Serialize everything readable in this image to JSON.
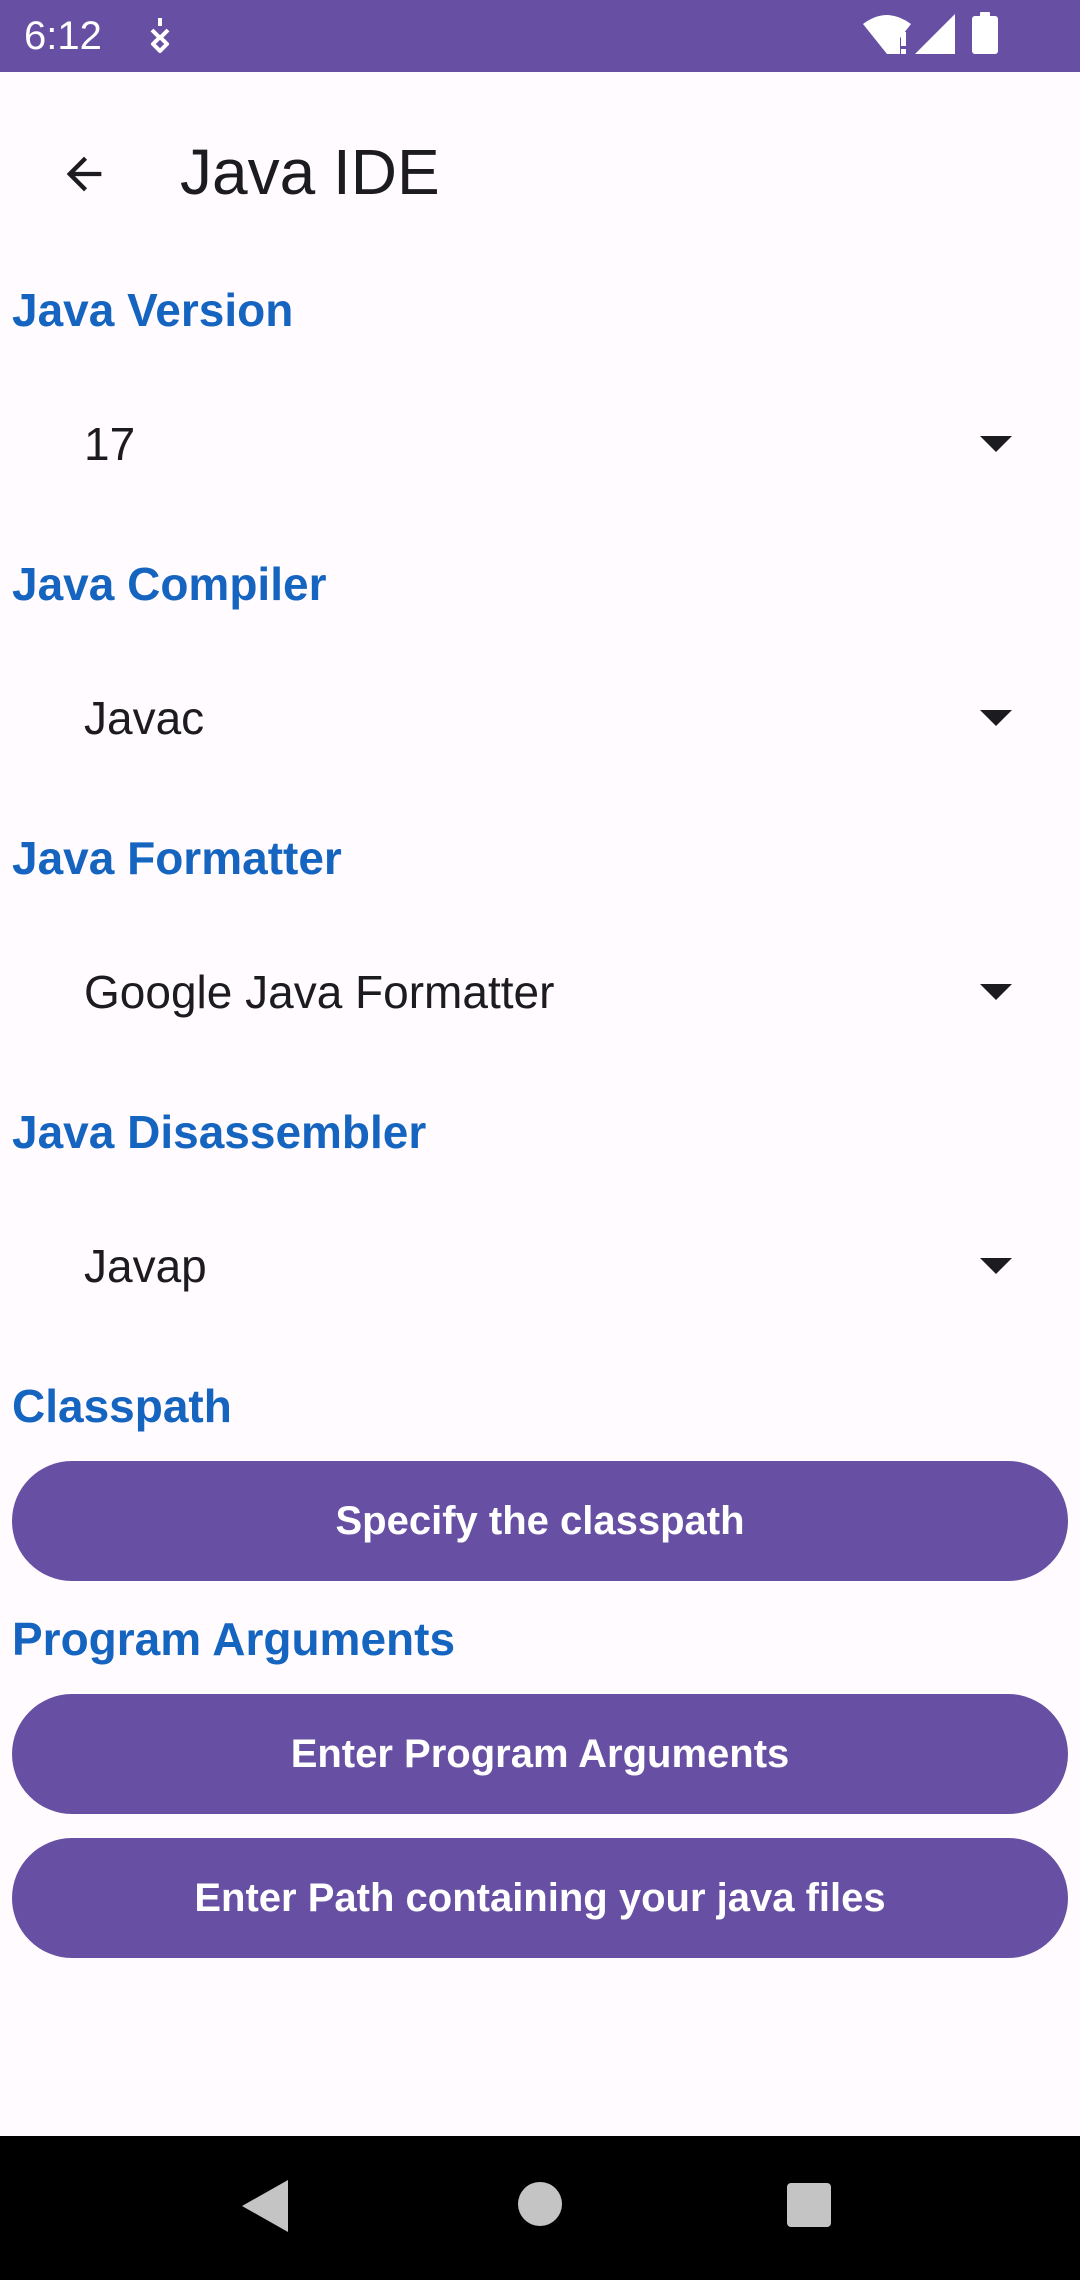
{
  "status_bar": {
    "time": "6:12",
    "background": "#6750a4",
    "icons": [
      "notification-icon",
      "wifi-icon",
      "signal-icon",
      "battery-icon"
    ]
  },
  "app_bar": {
    "title": "Java IDE",
    "back_icon": "arrow-back-icon"
  },
  "settings": {
    "java_version": {
      "label": "Java Version",
      "value": "17"
    },
    "java_compiler": {
      "label": "Java Compiler",
      "value": "Javac"
    },
    "java_formatter": {
      "label": "Java Formatter",
      "value": "Google Java Formatter"
    },
    "java_disassembler": {
      "label": "Java Disassembler",
      "value": "Javap"
    },
    "classpath": {
      "label": "Classpath",
      "button": "Specify the classpath"
    },
    "program_arguments": {
      "label": "Program Arguments",
      "button": "Enter Program Arguments"
    },
    "java_path": {
      "button": "Enter Path containing your java files"
    }
  },
  "nav_bar": {
    "icons": [
      "nav-back-icon",
      "nav-home-icon",
      "nav-recents-icon"
    ]
  },
  "colors": {
    "primary": "#6750a4",
    "section_label": "#1565c0",
    "background": "#fffbfe",
    "text": "#1c1b1f"
  }
}
